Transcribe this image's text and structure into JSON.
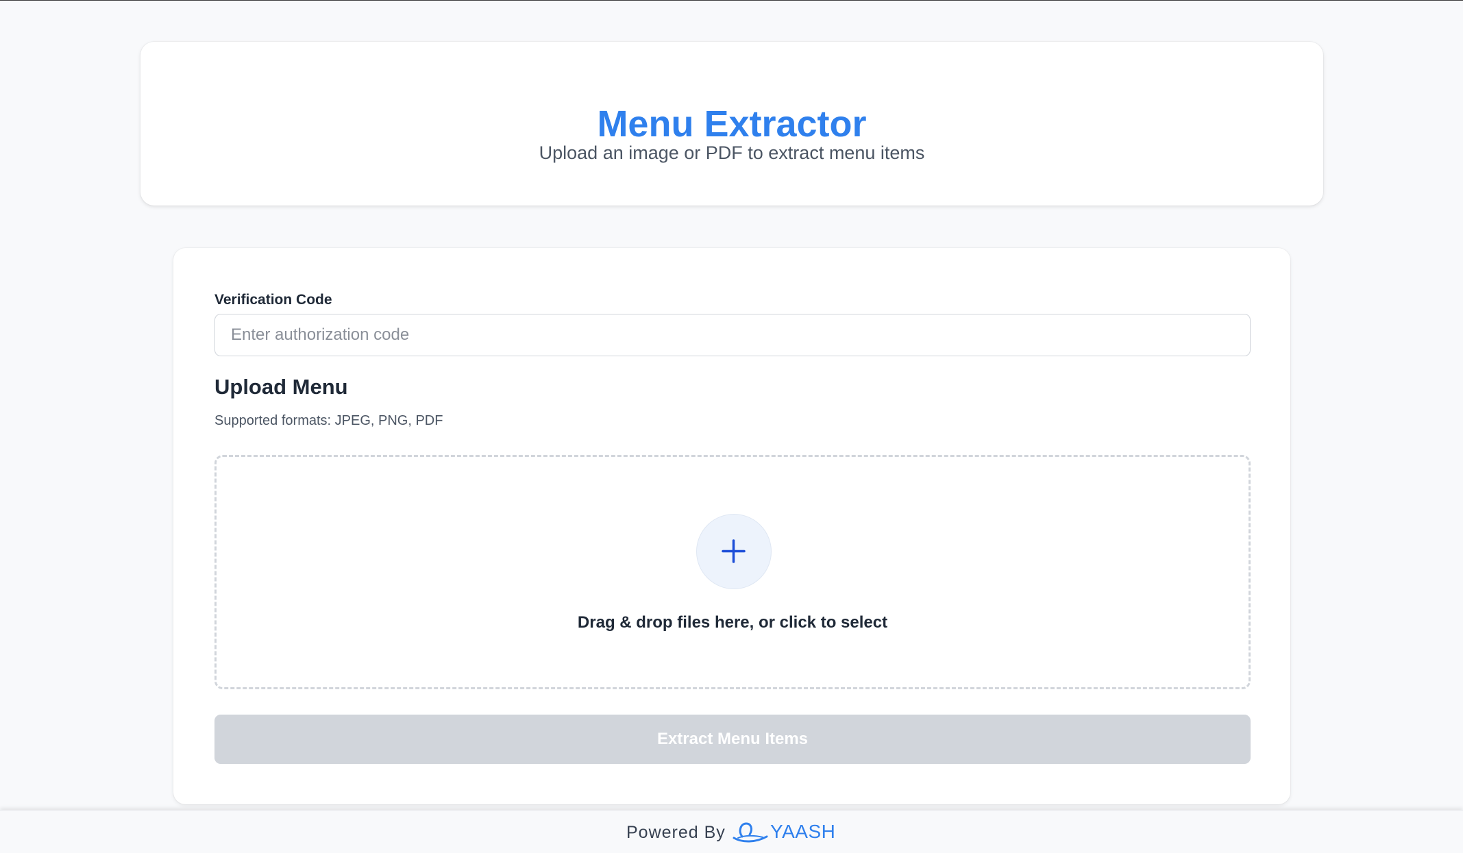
{
  "header": {
    "title": "Menu Extractor",
    "subtitle": "Upload an image or PDF to extract menu items"
  },
  "form": {
    "verification_label": "Verification Code",
    "verification_placeholder": "Enter authorization code",
    "verification_value": "",
    "upload_title": "Upload Menu",
    "supported_formats": "Supported formats: JPEG, PNG, PDF",
    "dropzone_icon": "plus-icon",
    "dropzone_text": "Drag & drop files here, or click to select",
    "extract_button_label": "Extract Menu Items",
    "extract_button_state": "disabled"
  },
  "footer": {
    "powered_by": "Powered By",
    "brand_icon": "yaash-logo-icon",
    "brand_name": "YAASH"
  },
  "colors": {
    "accent": "#2f80ed",
    "plus_icon": "#1d4ed8",
    "disabled_button": "#d1d5db",
    "page_background": "#f8f9fb"
  }
}
